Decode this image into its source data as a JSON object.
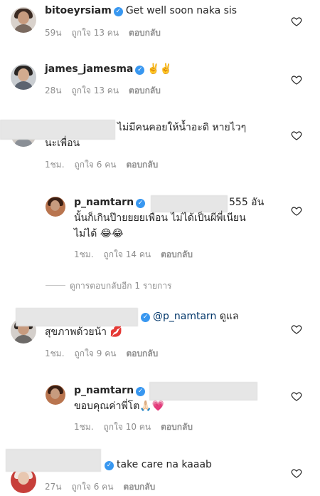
{
  "comments": [
    {
      "username": "bitoeyrsiam",
      "text": "Get well soon naka sis",
      "time": "59น",
      "likes": "ถูกใจ 13 คน",
      "reply": "ตอบกลับ"
    },
    {
      "username": "james_jamesma",
      "text": "✌️✌️",
      "time": "28น",
      "likes": "ถูกใจ 13 คน",
      "reply": "ตอบกลับ"
    },
    {
      "text_line1": "ไม่มีคนคอยให้น้ำอะดิ หายไวๆ",
      "text_line2": "นะเพื่อน",
      "time": "1ชม.",
      "likes": "ถูกใจ 6 คน",
      "reply": "ตอบกลับ"
    },
    {
      "username": "p_namtarn",
      "text_line1": "555 อัน",
      "text_line2": "นั้นก็เกินป๊ายยยยเพือน ไม่ได้เป็นผีพี่เนียน",
      "text_line3": "ไม่ได้ 😂😂",
      "time": "1ชม.",
      "likes": "ถูกใจ 14 คน",
      "reply": "ตอบกลับ"
    },
    {
      "mention": "@p_namtarn",
      "text_line1": "ดูแล",
      "text_line2": "สุขภาพด้วยน้า 💋",
      "time": "1ชม.",
      "likes": "ถูกใจ 9 คน",
      "reply": "ตอบกลับ"
    },
    {
      "username": "p_namtarn",
      "text_line2": "ขอบคุณค่าพี่โต🙏🏻💗",
      "time": "1ชม.",
      "likes": "ถูกใจ 10 คน",
      "reply": "ตอบกลับ"
    },
    {
      "text": "take care na kaaab",
      "time": "27น",
      "likes": "ถูกใจ 6 คน",
      "reply": "ตอบกลับ"
    }
  ],
  "view_more_replies": "ดูการตอบกลับอีก 1 รายการ",
  "icons": {
    "verified": "verified-badge-icon",
    "heart": "heart-outline-icon"
  },
  "colors": {
    "verified": "#3897f0",
    "meta": "#8e8e8e",
    "text": "#262626"
  }
}
